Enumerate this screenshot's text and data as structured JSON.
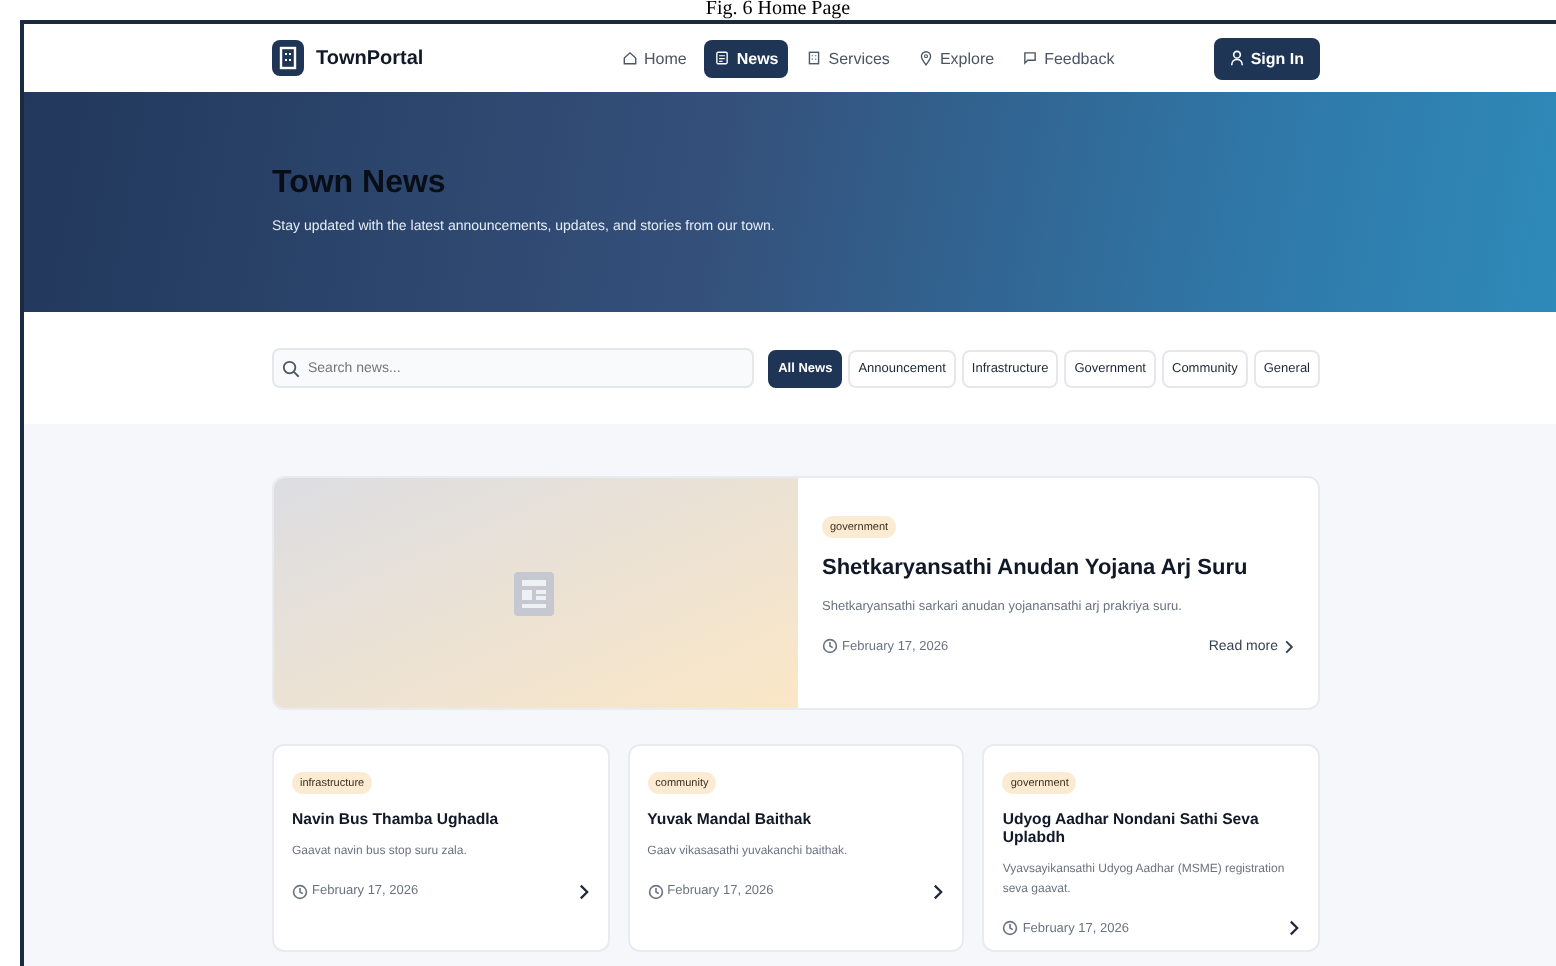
{
  "caption": "Fig. 6 Home Page",
  "navbar": {
    "brand": "TownPortal",
    "links": [
      {
        "label": "Home",
        "selected": false
      },
      {
        "label": "News",
        "selected": true
      },
      {
        "label": "Services",
        "selected": false
      },
      {
        "label": "Explore",
        "selected": false
      },
      {
        "label": "Feedback",
        "selected": false
      }
    ],
    "sign_in": "Sign In"
  },
  "hero": {
    "title": "Town News",
    "subtitle": "Stay updated with the latest announcements, updates, and stories from our town."
  },
  "search": {
    "placeholder": "Search news..."
  },
  "filters": [
    {
      "label": "All News",
      "selected": true
    },
    {
      "label": "Announcement",
      "selected": false
    },
    {
      "label": "Infrastructure",
      "selected": false
    },
    {
      "label": "Government",
      "selected": false
    },
    {
      "label": "Community",
      "selected": false
    },
    {
      "label": "General",
      "selected": false
    }
  ],
  "featured": {
    "tag": "government",
    "title": "Shetkaryansathi Anudan Yojana Arj Suru",
    "summary": "Shetkaryansathi sarkari anudan yojanansathi arj prakriya suru.",
    "date": "February 17, 2026",
    "link": "Read more"
  },
  "articles": [
    {
      "tag": "infrastructure",
      "title": "Navin Bus Thamba Ughadla",
      "summary": "Gaavat navin bus stop suru zala.",
      "date": "February 17, 2026"
    },
    {
      "tag": "community",
      "title": "Yuvak Mandal Baithak",
      "summary": "Gaav vikasasathi yuvakanchi baithak.",
      "date": "February 17, 2026"
    },
    {
      "tag": "government",
      "title": "Udyog Aadhar Nondani Sathi Seva Uplabdh",
      "summary": "Vyavsayikansathi Udyog Aadhar (MSME) registration seva gaavat.",
      "date": "February 17, 2026"
    }
  ]
}
